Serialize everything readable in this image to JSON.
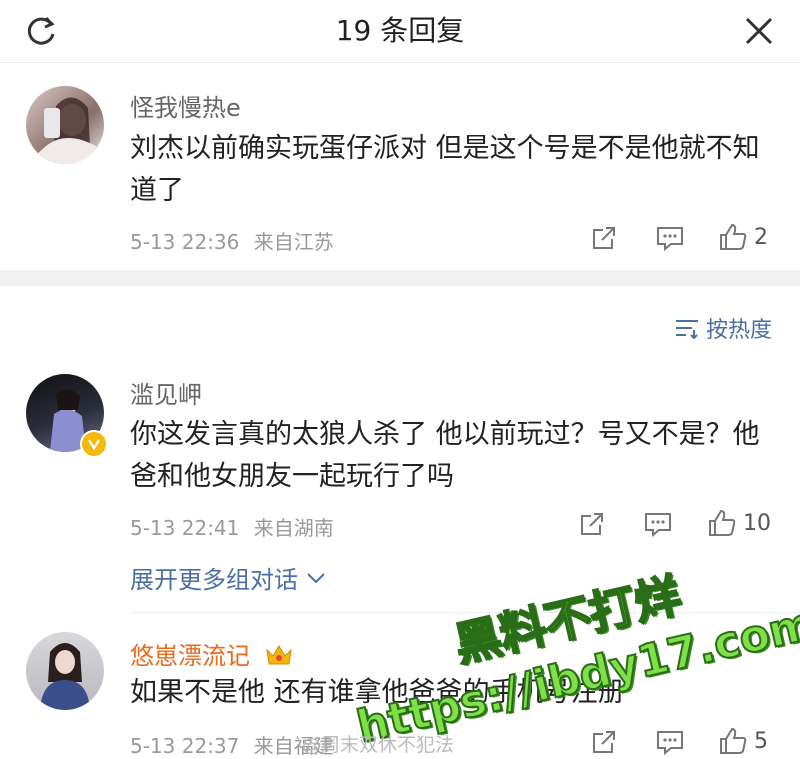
{
  "header": {
    "title": "19 条回复",
    "refresh_icon": "refresh-icon",
    "close_icon": "close-icon"
  },
  "comments": [
    {
      "user": "怪我慢热e",
      "text": "刘杰以前确实玩蛋仔派对 但是这个号是不是他就不知道了",
      "time": "5-13 22:36",
      "location": "来自江苏",
      "likes": "2",
      "name_color": "#666666"
    },
    {
      "user": "滥见岬",
      "text": "你这发言真的太狼人杀了  他以前玩过？号又不是？他爸和他女朋友一起玩行了吗",
      "time": "5-13 22:41",
      "location": "来自湖南",
      "likes": "10",
      "name_color": "#666666",
      "verified": true
    },
    {
      "user": "悠崽漂流记",
      "text": "如果不是他 还有谁拿他爸爸的手机号注册",
      "time": "5-13 22:37",
      "location": "来自福建",
      "likes": "5",
      "name_color": "#e86a1a",
      "badge": "crown-icon"
    }
  ],
  "sort_label": "按热度",
  "expand_label": "展开更多组对话",
  "watermark": {
    "line1": "黑料不打烊",
    "line2": "https://ibdy17.com",
    "small": "@周末双休不犯法"
  },
  "colors": {
    "link": "#4a6fa5",
    "watermark_green": "#7fe048"
  }
}
